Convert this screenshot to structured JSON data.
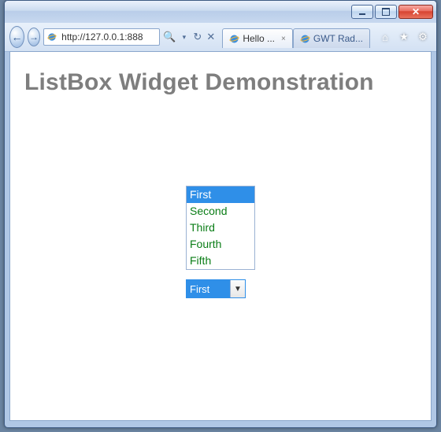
{
  "browser": {
    "address": "http://127.0.0.1:888",
    "tabs": [
      {
        "label": "Hello ...",
        "active": true
      },
      {
        "label": "GWT Rad...",
        "active": false
      }
    ]
  },
  "page": {
    "heading": "ListBox Widget Demonstration"
  },
  "listbox": {
    "options": [
      "First",
      "Second",
      "Third",
      "Fourth",
      "Fifth"
    ],
    "selected_index": 0
  },
  "dropdown": {
    "selected": "First"
  },
  "glyphs": {
    "back": "←",
    "forward": "→",
    "search": "🔍",
    "refresh": "↻",
    "stop": "✕",
    "home": "⌂",
    "star": "★",
    "gear": "⚙",
    "close_tab": "×",
    "close_win": "✕",
    "dropdown": "▼"
  }
}
